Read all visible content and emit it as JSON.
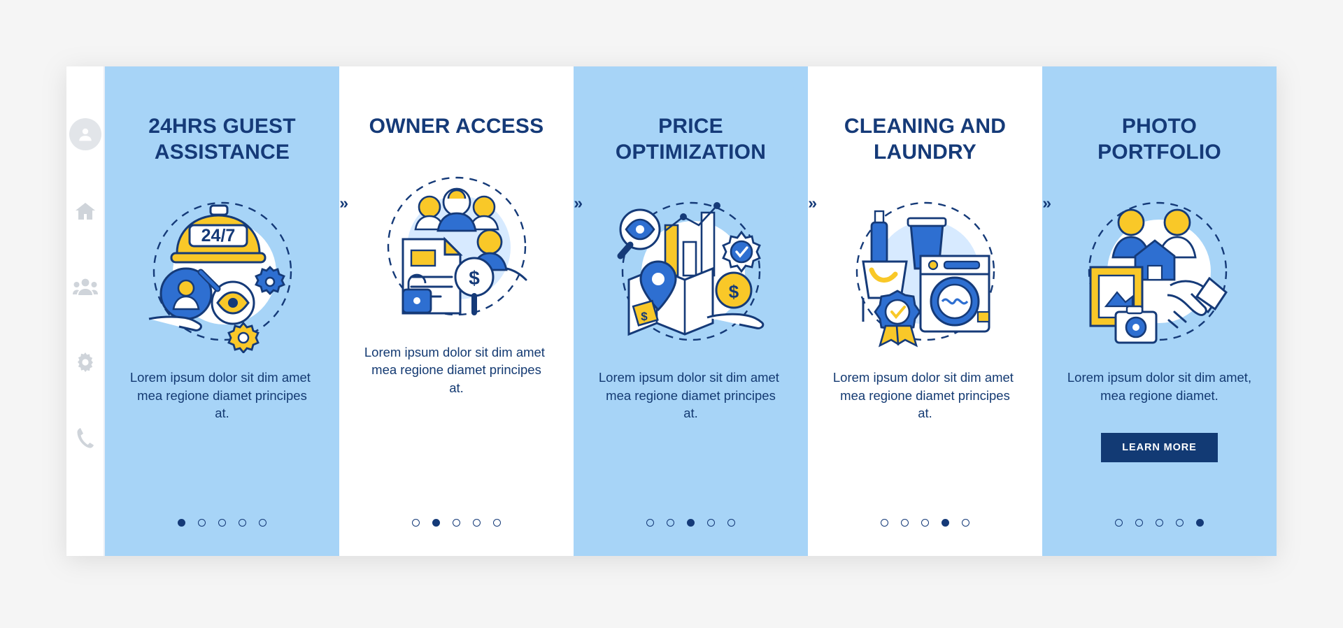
{
  "sidebar": {
    "items": [
      {
        "name": "avatar",
        "icon": "user-avatar-icon"
      },
      {
        "name": "home",
        "icon": "home-icon"
      },
      {
        "name": "people",
        "icon": "people-icon"
      },
      {
        "name": "settings",
        "icon": "gear-icon"
      },
      {
        "name": "phone",
        "icon": "phone-icon"
      }
    ]
  },
  "colors": {
    "panel_blue": "#a7d4f7",
    "panel_white": "#ffffff",
    "navy": "#153a78",
    "accent_yellow": "#f9c828",
    "accent_blue": "#2e6fd1",
    "page_bg": "#f5f5f5"
  },
  "separator": {
    "glyph": "»",
    "count": 4
  },
  "panels": [
    {
      "title": "24HRS GUEST ASSISTANCE",
      "description": "Lorem ipsum dolor sit dim amet, mea regione diamet principes at.",
      "illustration": "concierge-bell-24-7-icon",
      "badge_text": "24/7",
      "dots_total": 5,
      "dots_active": 1,
      "theme": "blue",
      "has_button": false,
      "button_label": ""
    },
    {
      "title": "OWNER ACCESS",
      "description": "Lorem ipsum dolor sit dim amet, mea regione diamet principes at.",
      "illustration": "owner-access-document-lock-icon",
      "badge_text": "",
      "dots_total": 5,
      "dots_active": 2,
      "theme": "white",
      "has_button": false,
      "button_label": ""
    },
    {
      "title": "PRICE OPTIMIZATION",
      "description": "Lorem ipsum dolor sit dim amet, mea regione diamet principes at.",
      "illustration": "price-optimization-chart-map-icon",
      "badge_text": "",
      "dots_total": 5,
      "dots_active": 3,
      "theme": "blue",
      "has_button": false,
      "button_label": ""
    },
    {
      "title": "CLEANING AND LAUNDRY",
      "description": "Lorem ipsum dolor sit dim amet, mea regione diamet principes at.",
      "illustration": "washing-machine-cleaning-icon",
      "badge_text": "",
      "dots_total": 5,
      "dots_active": 4,
      "theme": "white",
      "has_button": false,
      "button_label": ""
    },
    {
      "title": "PHOTO PORTFOLIO",
      "description": "Lorem ipsum dolor sit dim amet, mea regione diamet.",
      "illustration": "photo-portfolio-handshake-icon",
      "badge_text": "",
      "dots_total": 5,
      "dots_active": 5,
      "theme": "blue",
      "has_button": true,
      "button_label": "LEARN MORE"
    }
  ]
}
